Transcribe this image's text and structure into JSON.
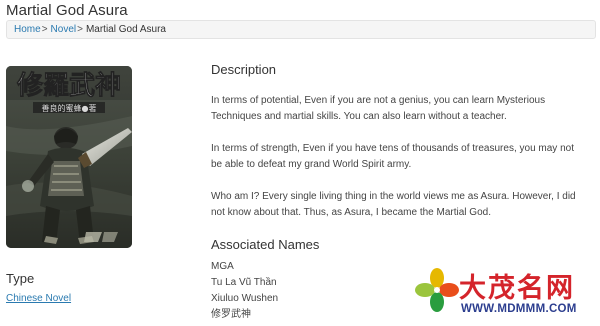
{
  "page": {
    "title": "Martial God Asura"
  },
  "breadcrumb": [
    {
      "label": "Home"
    },
    {
      "label": "Novel"
    },
    {
      "label": "Martial God Asura"
    }
  ],
  "breadcrumb_separator": ">",
  "cover": {
    "title_text": "修羅武神",
    "author_text": "善良的蜜蜂●著"
  },
  "type": {
    "heading": "Type",
    "value": "Chinese Novel"
  },
  "description": {
    "heading": "Description",
    "paragraphs": [
      "In terms of potential, Even if you are not a genius, you can learn Mysterious Techniques and martial skills. You can also learn without a teacher.",
      "In terms of strength, Even if you have tens of thousands of treasures, you may not be able to defeat my grand World Spirit army.",
      "Who am I? Every single living thing in the world views me as Asura. However, I did not know about that. Thus, as Asura, I became the Martial God."
    ]
  },
  "associated_names": {
    "heading": "Associated Names",
    "names": [
      "MGA",
      "Tu La Vũ Thần",
      "Xiuluo Wushen",
      "修罗武神"
    ]
  },
  "watermark": {
    "name": "大茂名网",
    "url": "WWW.MDMMM.COM"
  },
  "colors": {
    "link": "#2a7ab0",
    "watermark_red": "#d4242b",
    "watermark_blue": "#2c3e8f"
  }
}
